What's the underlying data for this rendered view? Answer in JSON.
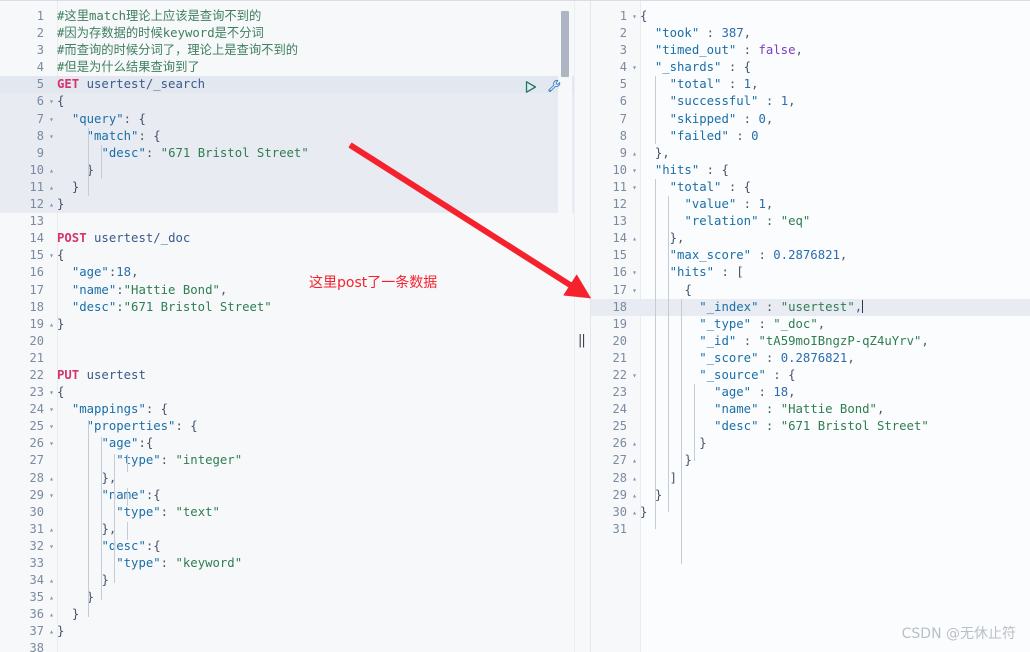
{
  "window": {
    "title": "Kibana Dev Tools Console"
  },
  "annotation": {
    "text": "这里post了一条数据",
    "color": "#f5222d",
    "arrow_label": "red-arrow-to-response"
  },
  "watermark": {
    "text": "CSDN @无休止符"
  },
  "toolbar": {
    "run_label": "▷",
    "run_name": "play-run-icon",
    "wrench_name": "wrench-icon"
  },
  "divider": {
    "handle": "||"
  },
  "left_editor": {
    "name": "request-editor",
    "scroll_thumb_visible": true,
    "lines": [
      {
        "n": 1,
        "fold": "",
        "text": "#这里match理论上应该是查询不到的",
        "cls": "c-comment",
        "hl": ""
      },
      {
        "n": 2,
        "fold": "",
        "text": "#因为存数据的时候keyword是不分词",
        "cls": "c-comment",
        "hl": ""
      },
      {
        "n": 3,
        "fold": "",
        "text": "#而查询的时候分词了，理论上是查询不到的",
        "cls": "c-comment",
        "hl": ""
      },
      {
        "n": 4,
        "fold": "",
        "text": "#但是为什么结果查询到了",
        "cls": "c-comment",
        "hl": ""
      },
      {
        "n": 5,
        "fold": "",
        "text": "GET usertest/_search",
        "cls": "c-request",
        "hl": "hl-active"
      },
      {
        "n": 6,
        "fold": "▾",
        "text": "{",
        "cls": "c-brace",
        "hl": "hl-block"
      },
      {
        "n": 7,
        "fold": "▾",
        "text": "  \"query\": {",
        "cls": "c-json",
        "hl": "hl-block"
      },
      {
        "n": 8,
        "fold": "▾",
        "text": "    \"match\": {",
        "cls": "c-json",
        "hl": "hl-block"
      },
      {
        "n": 9,
        "fold": "",
        "text": "      \"desc\": \"671 Bristol Street\"",
        "cls": "c-json",
        "hl": "hl-block"
      },
      {
        "n": 10,
        "fold": "▴",
        "text": "    }",
        "cls": "c-brace",
        "hl": "hl-block"
      },
      {
        "n": 11,
        "fold": "▴",
        "text": "  }",
        "cls": "c-brace",
        "hl": "hl-block"
      },
      {
        "n": 12,
        "fold": "▴",
        "text": "}",
        "cls": "c-brace",
        "hl": "hl-block"
      },
      {
        "n": 13,
        "fold": "",
        "text": "",
        "cls": "",
        "hl": ""
      },
      {
        "n": 14,
        "fold": "",
        "text": "POST usertest/_doc",
        "cls": "c-request",
        "hl": ""
      },
      {
        "n": 15,
        "fold": "▾",
        "text": "{",
        "cls": "c-brace",
        "hl": ""
      },
      {
        "n": 16,
        "fold": "",
        "text": "  \"age\":18,",
        "cls": "c-json",
        "hl": ""
      },
      {
        "n": 17,
        "fold": "",
        "text": "  \"name\":\"Hattie Bond\",",
        "cls": "c-json",
        "hl": ""
      },
      {
        "n": 18,
        "fold": "",
        "text": "  \"desc\":\"671 Bristol Street\"",
        "cls": "c-json",
        "hl": ""
      },
      {
        "n": 19,
        "fold": "▴",
        "text": "}",
        "cls": "c-brace",
        "hl": ""
      },
      {
        "n": 20,
        "fold": "",
        "text": "",
        "cls": "",
        "hl": ""
      },
      {
        "n": 21,
        "fold": "",
        "text": "",
        "cls": "",
        "hl": ""
      },
      {
        "n": 22,
        "fold": "",
        "text": "PUT usertest",
        "cls": "c-request",
        "hl": ""
      },
      {
        "n": 23,
        "fold": "▾",
        "text": "{",
        "cls": "c-brace",
        "hl": ""
      },
      {
        "n": 24,
        "fold": "▾",
        "text": "  \"mappings\": {",
        "cls": "c-json",
        "hl": ""
      },
      {
        "n": 25,
        "fold": "▾",
        "text": "    \"properties\": {",
        "cls": "c-json",
        "hl": ""
      },
      {
        "n": 26,
        "fold": "▾",
        "text": "      \"age\":{",
        "cls": "c-json",
        "hl": ""
      },
      {
        "n": 27,
        "fold": "",
        "text": "        \"type\": \"integer\"",
        "cls": "c-json",
        "hl": ""
      },
      {
        "n": 28,
        "fold": "▴",
        "text": "      },",
        "cls": "c-brace",
        "hl": ""
      },
      {
        "n": 29,
        "fold": "▾",
        "text": "      \"name\":{",
        "cls": "c-json",
        "hl": ""
      },
      {
        "n": 30,
        "fold": "",
        "text": "        \"type\": \"text\"",
        "cls": "c-json",
        "hl": ""
      },
      {
        "n": 31,
        "fold": "▴",
        "text": "      },",
        "cls": "c-brace",
        "hl": ""
      },
      {
        "n": 32,
        "fold": "▾",
        "text": "      \"desc\":{",
        "cls": "c-json",
        "hl": ""
      },
      {
        "n": 33,
        "fold": "",
        "text": "        \"type\": \"keyword\"",
        "cls": "c-json",
        "hl": ""
      },
      {
        "n": 34,
        "fold": "▴",
        "text": "      }",
        "cls": "c-brace",
        "hl": ""
      },
      {
        "n": 35,
        "fold": "▴",
        "text": "    }",
        "cls": "c-brace",
        "hl": ""
      },
      {
        "n": 36,
        "fold": "▴",
        "text": "  }",
        "cls": "c-brace",
        "hl": ""
      },
      {
        "n": 37,
        "fold": "▴",
        "text": "}",
        "cls": "c-brace",
        "hl": ""
      },
      {
        "n": 38,
        "fold": "",
        "text": "",
        "cls": "",
        "hl": ""
      }
    ]
  },
  "right_editor": {
    "name": "response-viewer",
    "lines": [
      {
        "n": 1,
        "fold": "▾",
        "text": "{",
        "hl": ""
      },
      {
        "n": 2,
        "fold": "",
        "text": "  \"took\" : 387,",
        "hl": ""
      },
      {
        "n": 3,
        "fold": "",
        "text": "  \"timed_out\" : false,",
        "hl": ""
      },
      {
        "n": 4,
        "fold": "▾",
        "text": "  \"_shards\" : {",
        "hl": ""
      },
      {
        "n": 5,
        "fold": "",
        "text": "    \"total\" : 1,",
        "hl": ""
      },
      {
        "n": 6,
        "fold": "",
        "text": "    \"successful\" : 1,",
        "hl": ""
      },
      {
        "n": 7,
        "fold": "",
        "text": "    \"skipped\" : 0,",
        "hl": ""
      },
      {
        "n": 8,
        "fold": "",
        "text": "    \"failed\" : 0",
        "hl": ""
      },
      {
        "n": 9,
        "fold": "▴",
        "text": "  },",
        "hl": ""
      },
      {
        "n": 10,
        "fold": "▾",
        "text": "  \"hits\" : {",
        "hl": ""
      },
      {
        "n": 11,
        "fold": "▾",
        "text": "    \"total\" : {",
        "hl": ""
      },
      {
        "n": 12,
        "fold": "",
        "text": "      \"value\" : 1,",
        "hl": ""
      },
      {
        "n": 13,
        "fold": "",
        "text": "      \"relation\" : \"eq\"",
        "hl": ""
      },
      {
        "n": 14,
        "fold": "▴",
        "text": "    },",
        "hl": ""
      },
      {
        "n": 15,
        "fold": "",
        "text": "    \"max_score\" : 0.2876821,",
        "hl": ""
      },
      {
        "n": 16,
        "fold": "▾",
        "text": "    \"hits\" : [",
        "hl": ""
      },
      {
        "n": 17,
        "fold": "▾",
        "text": "      {",
        "hl": ""
      },
      {
        "n": 18,
        "fold": "",
        "text": "        \"_index\" : \"usertest\",",
        "hl": "hl-cursor"
      },
      {
        "n": 19,
        "fold": "",
        "text": "        \"_type\" : \"_doc\",",
        "hl": ""
      },
      {
        "n": 20,
        "fold": "",
        "text": "        \"_id\" : \"tA59moIBngzP-qZ4uYrv\",",
        "hl": ""
      },
      {
        "n": 21,
        "fold": "",
        "text": "        \"_score\" : 0.2876821,",
        "hl": ""
      },
      {
        "n": 22,
        "fold": "▾",
        "text": "        \"_source\" : {",
        "hl": ""
      },
      {
        "n": 23,
        "fold": "",
        "text": "          \"age\" : 18,",
        "hl": ""
      },
      {
        "n": 24,
        "fold": "",
        "text": "          \"name\" : \"Hattie Bond\",",
        "hl": ""
      },
      {
        "n": 25,
        "fold": "",
        "text": "          \"desc\" : \"671 Bristol Street\"",
        "hl": ""
      },
      {
        "n": 26,
        "fold": "▴",
        "text": "        }",
        "hl": ""
      },
      {
        "n": 27,
        "fold": "▴",
        "text": "      }",
        "hl": ""
      },
      {
        "n": 28,
        "fold": "▴",
        "text": "    ]",
        "hl": ""
      },
      {
        "n": 29,
        "fold": "▴",
        "text": "  }",
        "hl": ""
      },
      {
        "n": 30,
        "fold": "▴",
        "text": "}",
        "hl": ""
      },
      {
        "n": 31,
        "fold": "",
        "text": "",
        "hl": ""
      }
    ]
  },
  "colors": {
    "comment": "#3f7f5f",
    "method": "#d6336c",
    "key": "#1a6fa8",
    "string": "#2f7d52",
    "number": "#2b6cb0",
    "boolean": "#7a3fc0",
    "annotation": "#f5222d",
    "highlight_block": "#e8ebf2",
    "background": "#f7f8fa"
  }
}
